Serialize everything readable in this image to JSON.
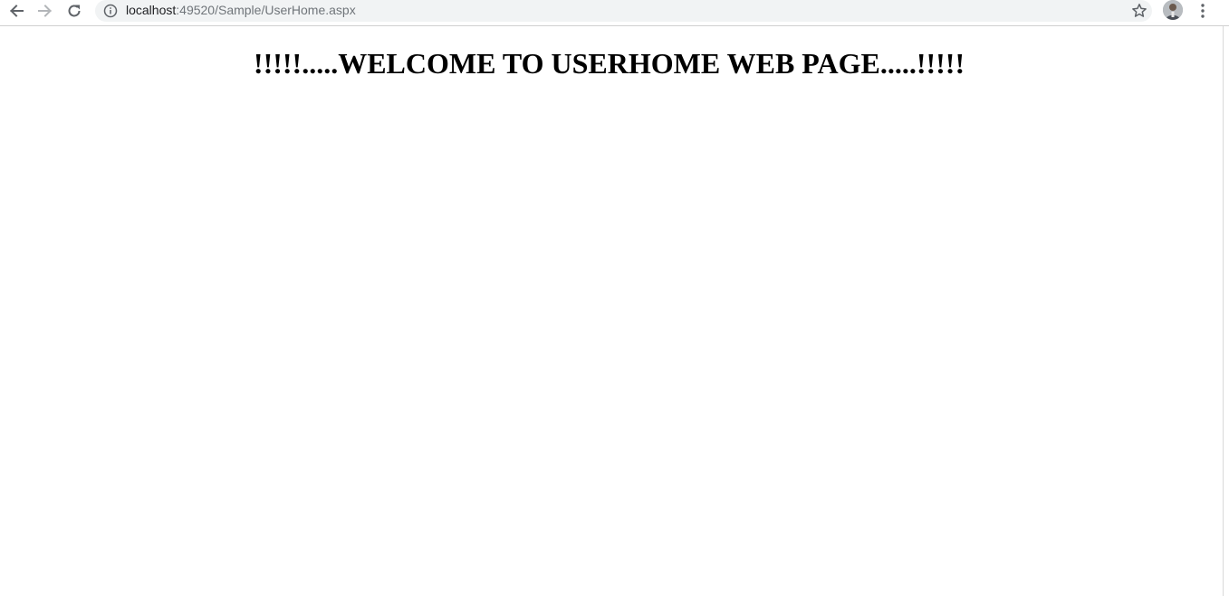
{
  "browser": {
    "url_host": "localhost",
    "url_path": ":49520/Sample/UserHome.aspx",
    "icons": {
      "back": "back-arrow-icon",
      "forward": "forward-arrow-icon",
      "reload": "reload-icon",
      "info": "info-icon",
      "bookmark": "star-icon",
      "profile": "avatar",
      "menu": "kebab-menu-icon"
    }
  },
  "page": {
    "heading": "!!!!!.....WELCOME TO USERHOME WEB PAGE.....!!!!!"
  },
  "colors": {
    "omnibox_bg": "#f1f3f4",
    "url_host": "#202124",
    "url_path": "#70757a",
    "heading": "#000000"
  }
}
